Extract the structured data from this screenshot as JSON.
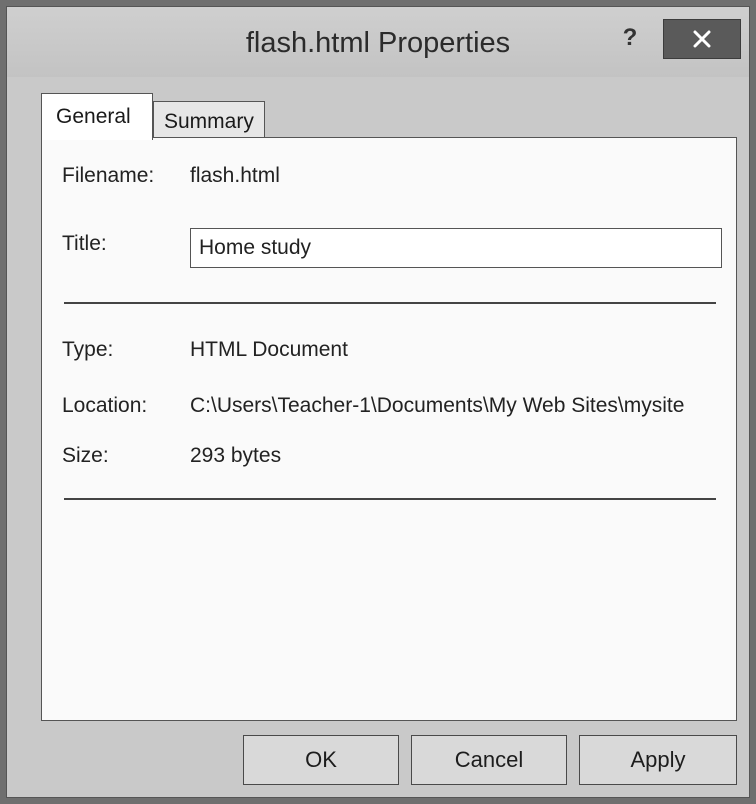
{
  "window": {
    "title": "flash.html Properties",
    "help_label": "?",
    "close_icon": "close-icon"
  },
  "tabs": [
    {
      "label": "General",
      "selected": true
    },
    {
      "label": "Summary",
      "selected": false
    }
  ],
  "general": {
    "filename_label": "Filename:",
    "filename_value": "flash.html",
    "title_label": "Title:",
    "title_value": "Home study",
    "type_label": "Type:",
    "type_value": "HTML Document",
    "location_label": "Location:",
    "location_value": "C:\\Users\\Teacher-1\\Documents\\My Web Sites\\mysite",
    "size_label": "Size:",
    "size_value": "293 bytes"
  },
  "buttons": {
    "ok": "OK",
    "cancel": "Cancel",
    "apply": "Apply"
  }
}
